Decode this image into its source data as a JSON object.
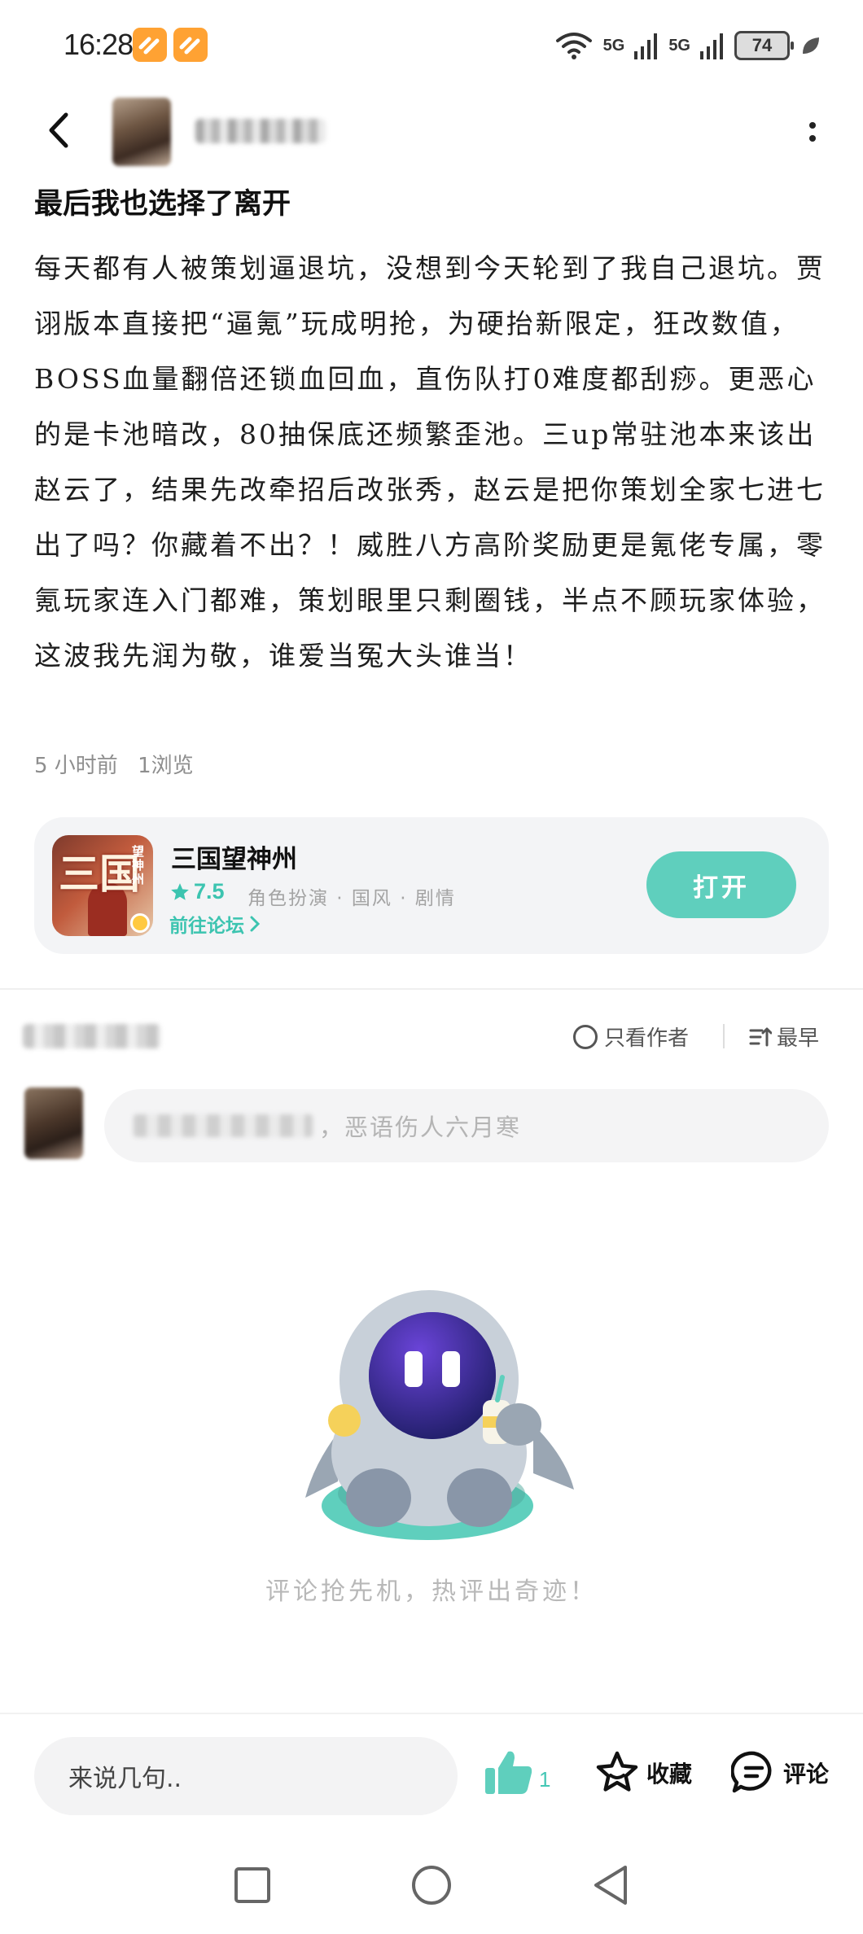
{
  "status_bar": {
    "time": "16:28",
    "network_1": "5G",
    "network_2": "5G",
    "battery": "74"
  },
  "header": {
    "back_icon": "back-arrow-icon",
    "more_icon": "more-vertical-icon"
  },
  "post": {
    "title": "最后我也选择了离开",
    "body": "每天都有人被策划逼退坑，没想到今天轮到了我自己退坑。贾诩版本直接把“逼氪”玩成明抢，为硬抬新限定，狂改数值，BOSS血量翻倍还锁血回血，直伤队打0难度都刮痧。更恶心的是卡池暗改，80抽保底还频繁歪池。三up常驻池本来该出赵云了，结果先改牵招后改张秀，赵云是把你策划全家七进七出了吗？你藏着不出？！威胜八方高阶奖励更是氪佬专属，零氪玩家连入门都难，策划眼里只剩圈钱，半点不顾玩家体验，这波我先润为敬，谁爱当冤大头谁当！",
    "time_ago": "5 小时前",
    "views": "1浏览"
  },
  "game_card": {
    "name": "三国望神州",
    "icon_text": "三国",
    "icon_sub": "望神州",
    "rating": "7.5",
    "tags": "角色扮演 · 国风 · 剧情",
    "forum_link": "前往论坛",
    "open_button": "打开"
  },
  "comments": {
    "filter_author": "只看作者",
    "sort_label": "最早",
    "input_placeholder": "，恶语伤人六月寒",
    "empty_text": "评论抢先机，热评出奇迹！"
  },
  "bottom_bar": {
    "reply_placeholder": "来说几句..",
    "like_count": "1",
    "favorite_label": "收藏",
    "comment_label": "评论"
  },
  "colors": {
    "accent": "#5fcfbd",
    "accent_text": "#3cc4b0"
  }
}
